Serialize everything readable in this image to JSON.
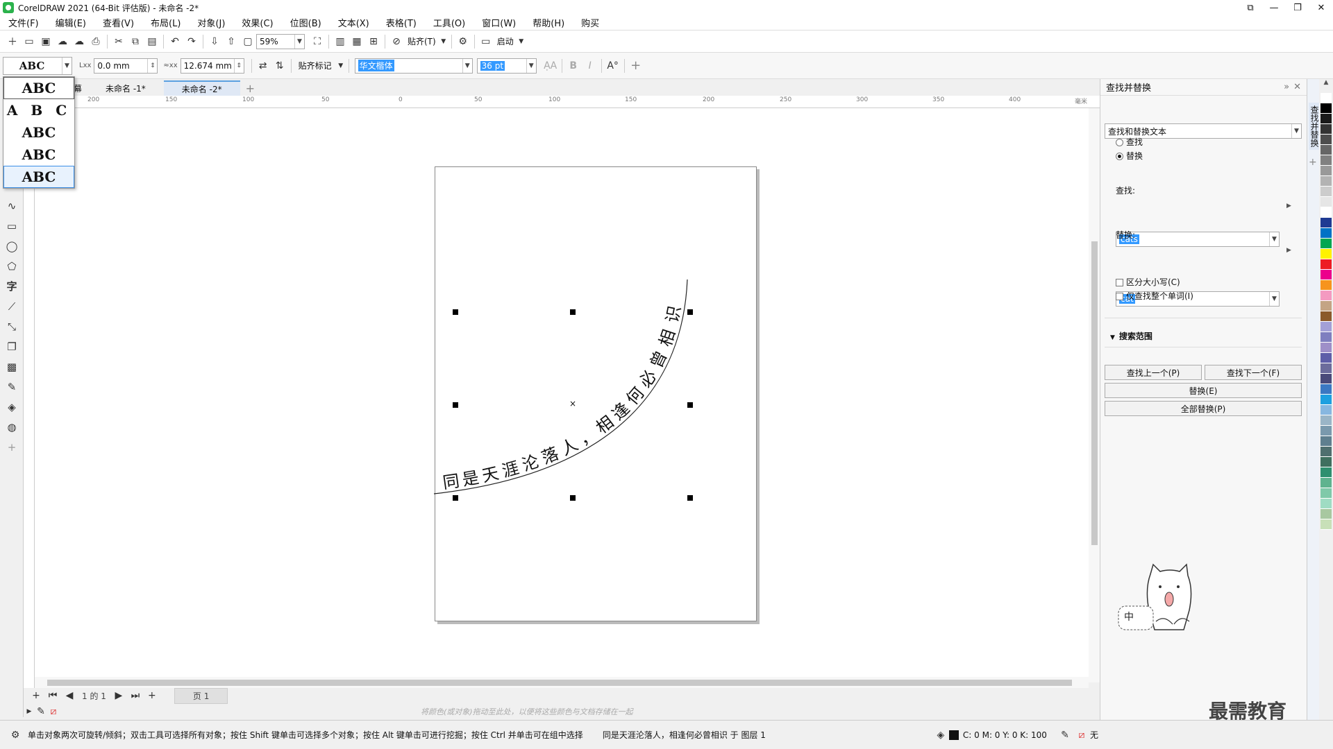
{
  "app": {
    "title": "CorelDRAW 2021 (64-Bit 评估版) - 未命名 -2*",
    "window_buttons": [
      "⧉",
      "—",
      "❐",
      "✕"
    ]
  },
  "menu": [
    "文件(F)",
    "编辑(E)",
    "查看(V)",
    "布局(L)",
    "对象(J)",
    "效果(C)",
    "位图(B)",
    "文本(X)",
    "表格(T)",
    "工具(O)",
    "窗口(W)",
    "帮助(H)",
    "购买"
  ],
  "toolbar": {
    "zoom": "59%",
    "snap_label": "贴齐(T)",
    "launch_label": "启动"
  },
  "propbar": {
    "preset_label": "ABC",
    "offset_label": "Lxx",
    "offset_value": "0.0 mm",
    "distance_label": "≈xx",
    "distance_value": "12.674 mm",
    "snap_marks": "贴齐标记",
    "font": "华文楷体",
    "size": "36 pt",
    "presets": [
      "ABC",
      "A B C",
      "ABC",
      "ABC",
      "ABC"
    ]
  },
  "tabs": [
    "幕",
    "未命名 -1*",
    "未命名 -2*"
  ],
  "ruler": {
    "h_labels": [
      "200",
      "150",
      "100",
      "50",
      "0",
      "50",
      "100",
      "150",
      "200",
      "250",
      "300",
      "350",
      "400"
    ],
    "unit": "毫米"
  },
  "canvas": {
    "path_text": [
      "同",
      "是",
      "天",
      "涯",
      "沦",
      "落",
      "人",
      "，",
      "相",
      "逢",
      "何",
      "必",
      "曾",
      "相",
      "识"
    ]
  },
  "pagenav": {
    "page_of": "1 的 1",
    "page_tab": "页 1"
  },
  "colordoc": {
    "hint": "将颜色(或对象)拖动至此处，以便将这些颜色与文档存储在一起"
  },
  "status": {
    "hint": "单击对象两次可旋转/倾斜；双击工具可选择所有对象；按住 Shift 键单击可选择多个对象；按住 Alt 键单击可进行挖掘；按住 Ctrl 并单击可在组中选择",
    "object": "同是天涯沦落人，相逢何必曾相识 于 图层 1",
    "fill": "C: 0 M: 0 Y: 0 K: 100",
    "outline": "无"
  },
  "docker": {
    "title": "查找并替换",
    "mode": "查找和替换文本",
    "radio_find": "查找",
    "radio_replace": "替换",
    "find_label": "查找:",
    "find_value": "cats",
    "replace_label": "替换:",
    "replace_value": "cat",
    "match_case": "区分大小写(C)",
    "whole_word": "仅查找整个单词(I)",
    "scope": "搜索范围",
    "find_prev": "查找上一个(P)",
    "find_next": "查找下一个(F)",
    "replace_btn": "替换(E)",
    "replace_all": "全部替换(P)",
    "side_tab": "查找并替换"
  },
  "watermark": "最需教育",
  "mascot_text": "中",
  "colors": {
    "accent": "#3399ff",
    "palette": [
      "#ffffff",
      "#000000",
      "#1a1a1a",
      "#333333",
      "#4d4d4d",
      "#666666",
      "#808080",
      "#999999",
      "#b3b3b3",
      "#cccccc",
      "#e6e6e6",
      "#ffffff",
      "#1f3a93",
      "#0072c6",
      "#00a651",
      "#fff200",
      "#ed1c24",
      "#ec008c",
      "#f7941d",
      "#f49ac1",
      "#c4a484",
      "#8b5a2b",
      "#a3a0d6",
      "#7f7fbf",
      "#9e8fc8",
      "#5e5ea8",
      "#6c6c9c",
      "#4a4a7a",
      "#3b78c2",
      "#1ea0e0",
      "#87b7e0",
      "#9ab5c7",
      "#7a99ad",
      "#5f7f8f",
      "#4f6f6f",
      "#3f6f5f",
      "#2f8f6f",
      "#5fb38f",
      "#7fc9a9",
      "#9fdcc3",
      "#a8c8a0",
      "#c8e0b8"
    ]
  }
}
